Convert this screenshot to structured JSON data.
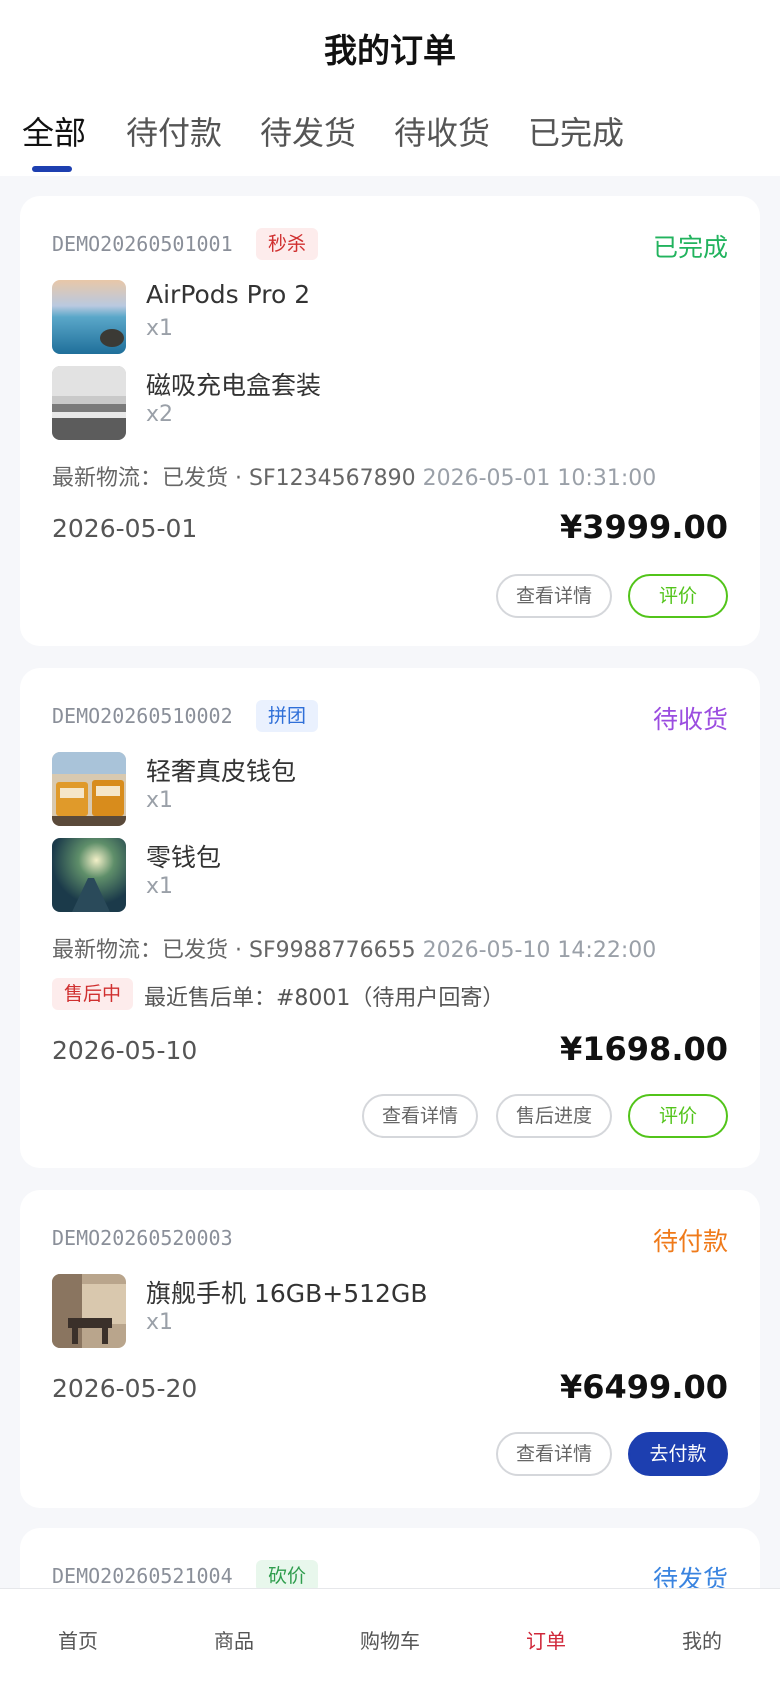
{
  "page_title": "我的订单",
  "tabs": [
    "全部",
    "待付款",
    "待发货",
    "待收货",
    "已完成"
  ],
  "orders": [
    {
      "order_no": "DEMO20260501001",
      "tag": "秒杀",
      "status": "已完成",
      "status_color": "#22b35e",
      "items": [
        {
          "name": "AirPods Pro 2",
          "qty": "x1"
        },
        {
          "name": "磁吸充电盒套装",
          "qty": "x2"
        }
      ],
      "logistics": "最新物流：已发货 · SF1234567890",
      "logistics_time": "2026-05-01 10:31:00",
      "date": "2026-05-01",
      "price": "¥3999.00",
      "buttons": [
        "查看详情",
        "评价"
      ]
    },
    {
      "order_no": "DEMO20260510002",
      "tag": "拼团",
      "status": "待收货",
      "status_color": "#9b4de0",
      "items": [
        {
          "name": "轻奢真皮钱包",
          "qty": "x1"
        },
        {
          "name": "零钱包",
          "qty": "x1"
        }
      ],
      "logistics": "最新物流：已发货 · SF9988776655",
      "logistics_time": "2026-05-10 14:22:00",
      "after_sale_tag": "售后中",
      "after_sale_text": "最近售后单：#8001（待用户回寄）",
      "date": "2026-05-10",
      "price": "¥1698.00",
      "buttons": [
        "查看详情",
        "售后进度",
        "评价"
      ]
    },
    {
      "order_no": "DEMO20260520003",
      "status": "待付款",
      "status_color": "#ef7a1a",
      "items": [
        {
          "name": "旗舰手机 16GB+512GB",
          "qty": "x1"
        }
      ],
      "date": "2026-05-20",
      "price": "¥6499.00",
      "buttons": [
        "查看详情",
        "去付款"
      ]
    },
    {
      "order_no": "DEMO20260521004",
      "tag": "砍价",
      "status": "待发货",
      "status_color": "#3a84e0"
    }
  ],
  "bottom_nav": [
    "首页",
    "商品",
    "购物车",
    "订单",
    "我的"
  ],
  "colors": {
    "accent": "#1d3fb0",
    "nav_active": "#d0283a",
    "review_green": "#52c41a"
  }
}
